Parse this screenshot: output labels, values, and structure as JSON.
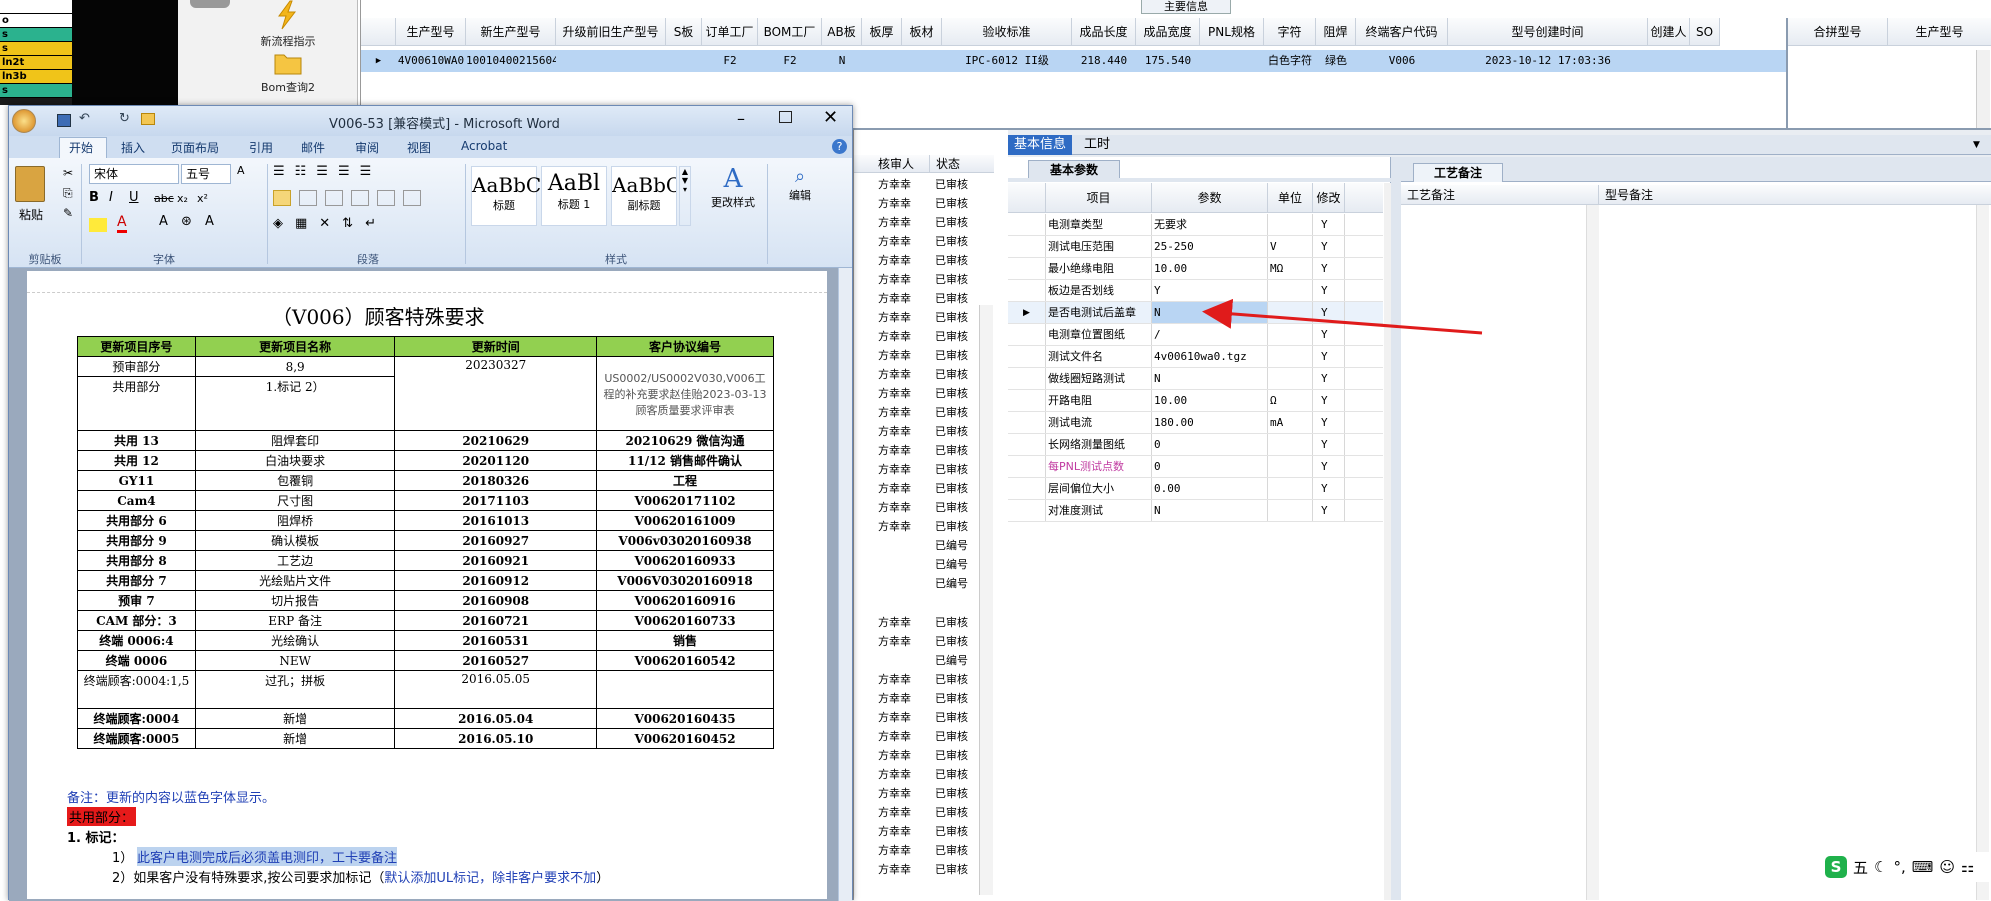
{
  "left_strip": {
    "items": [
      {
        "text": "",
        "bg": "#ffffff"
      },
      {
        "text": "o",
        "bg": "#ffffff"
      },
      {
        "text": "s",
        "bg": "#2bb28e"
      },
      {
        "text": "s",
        "bg": "#f0c419"
      },
      {
        "text": "ln2t",
        "bg": "#f0c419"
      },
      {
        "text": "ln3b",
        "bg": "#f0c419"
      },
      {
        "text": "s",
        "bg": "#2bb28e"
      }
    ]
  },
  "toolbar": {
    "new_flow_label": "新流程指示",
    "bom_label": "Bom查询2"
  },
  "top_grid": {
    "section_title": "主要信息",
    "headers": [
      "生产型号",
      "新生产型号",
      "升级前旧生产型号",
      "S板",
      "订单工厂",
      "BOM工厂",
      "AB板",
      "板厚",
      "板材",
      "验收标准",
      "成品长度",
      "成品宽度",
      "PNL规格",
      "字符",
      "阻焊",
      "终端客户代码",
      "型号创建时间",
      "创建人",
      "SO"
    ],
    "row": [
      "4V00610WA0",
      "10010400215604",
      "",
      "",
      "F2",
      "F2",
      "N",
      "",
      "",
      "IPC-6012 II级",
      "218.440",
      "175.540",
      "",
      "白色字符",
      "绿色",
      "V006",
      "2023-10-12 17:03:36",
      "",
      ""
    ],
    "right_headers": [
      "合拼型号",
      "生产型号"
    ]
  },
  "mid_col": {
    "headers": [
      "核审人",
      "状态"
    ],
    "rows": [
      [
        "方幸幸",
        "已审核"
      ],
      [
        "方幸幸",
        "已审核"
      ],
      [
        "方幸幸",
        "已审核"
      ],
      [
        "方幸幸",
        "已审核"
      ],
      [
        "方幸幸",
        "已审核"
      ],
      [
        "方幸幸",
        "已审核"
      ],
      [
        "方幸幸",
        "已审核"
      ],
      [
        "方幸幸",
        "已审核"
      ],
      [
        "方幸幸",
        "已审核"
      ],
      [
        "方幸幸",
        "已审核"
      ],
      [
        "方幸幸",
        "已审核"
      ],
      [
        "方幸幸",
        "已审核"
      ],
      [
        "方幸幸",
        "已审核"
      ],
      [
        "方幸幸",
        "已审核"
      ],
      [
        "方幸幸",
        "已审核"
      ],
      [
        "方幸幸",
        "已审核"
      ],
      [
        "方幸幸",
        "已审核"
      ],
      [
        "方幸幸",
        "已审核"
      ],
      [
        "方幸幸",
        "已审核"
      ],
      [
        "",
        "已编号"
      ],
      [
        "",
        "已编号"
      ],
      [
        "",
        "已编号"
      ],
      [
        "方幸幸",
        "已审核"
      ],
      [
        "方幸幸",
        "已审核"
      ],
      [
        "",
        "已编号"
      ],
      [
        "方幸幸",
        "已审核"
      ],
      [
        "方幸幸",
        "已审核"
      ],
      [
        "方幸幸",
        "已审核"
      ],
      [
        "方幸幸",
        "已审核"
      ],
      [
        "方幸幸",
        "已审核"
      ],
      [
        "方幸幸",
        "已审核"
      ],
      [
        "方幸幸",
        "已审核"
      ],
      [
        "方幸幸",
        "已审核"
      ],
      [
        "方幸幸",
        "已审核"
      ],
      [
        "方幸幸",
        "已审核"
      ],
      [
        "方幸幸",
        "已审核"
      ]
    ]
  },
  "right_panel": {
    "tabs": [
      "基本信息",
      "工时"
    ],
    "sub_tab": "基本参数",
    "craft_tab": "工艺备注",
    "param_headers": [
      "项目",
      "参数",
      "单位",
      "修改"
    ],
    "params": [
      [
        "电测章类型",
        "无要求",
        "",
        "Y"
      ],
      [
        "测试电压范围",
        "25-250",
        "V",
        "Y"
      ],
      [
        "最小绝缘电阻",
        "10.00",
        "MΩ",
        "Y"
      ],
      [
        "板边是否划线",
        "Y",
        "",
        "Y"
      ],
      [
        "是否电测试后盖章",
        "N",
        "",
        "Y"
      ],
      [
        "电测章位置图纸",
        "/",
        "",
        "Y"
      ],
      [
        "测试文件名",
        "4v00610wa0.tgz",
        "",
        "Y"
      ],
      [
        "做线圈短路测试",
        "N",
        "",
        "Y"
      ],
      [
        "开路电阻",
        "10.00",
        "Ω",
        "Y"
      ],
      [
        "测试电流",
        "180.00",
        "mA",
        "Y"
      ],
      [
        "长网络测量图纸",
        "0",
        "",
        "Y"
      ],
      [
        "每PNL测试点数",
        "0",
        "",
        "Y"
      ],
      [
        "层间偏位大小",
        "0.00",
        "",
        "Y"
      ],
      [
        "对准度测试",
        "N",
        "",
        "Y"
      ]
    ],
    "craft_headers": [
      "工艺备注",
      "型号备注"
    ]
  },
  "word": {
    "title": "V006-53 [兼容模式] - Microsoft Word",
    "tabs": [
      "开始",
      "插入",
      "页面布局",
      "引用",
      "邮件",
      "审阅",
      "视图",
      "Acrobat"
    ],
    "font_name": "宋体",
    "font_size": "五号",
    "groups": [
      "剪贴板",
      "字体",
      "段落",
      "样式"
    ],
    "paste_label": "粘贴",
    "styles": [
      {
        "sample": "AaBbC",
        "name": "标题"
      },
      {
        "sample": "AaBl",
        "name": "标题 1"
      },
      {
        "sample": "AaBbC",
        "name": "副标题"
      }
    ],
    "change_style": "更改样式",
    "edit": "编辑",
    "doc_title": "（V006）顾客特殊要求",
    "table_headers": [
      "更新项目序号",
      "更新项目名称",
      "更新时间",
      "客户协议编号"
    ],
    "table_rows": [
      [
        "预审部分",
        "8,9",
        "20230327",
        "US0002/US0002V030,V006工程的补充要求赵佳贻2023-03-13顾客质量要求评审表"
      ],
      [
        "共用部分",
        "1.标记 2）",
        "",
        ""
      ],
      [
        "共用 13",
        "阻焊套印",
        "20210629",
        "20210629 微信沟通"
      ],
      [
        "共用 12",
        "白油块要求",
        "20201120",
        "11/12 销售邮件确认"
      ],
      [
        "GY11",
        "包覆铜",
        "20180326",
        "工程"
      ],
      [
        "Cam4",
        "尺寸图",
        "20171103",
        "V00620171102"
      ],
      [
        "共用部分 6",
        "阻焊桥",
        "20161013",
        "V00620161009"
      ],
      [
        "共用部分 9",
        "确认模板",
        "20160927",
        "V006v03020160938"
      ],
      [
        "共用部分 8",
        "工艺边",
        "20160921",
        "V00620160933"
      ],
      [
        "共用部分 7",
        "光绘贴片文件",
        "20160912",
        "V006V03020160918"
      ],
      [
        "预审 7",
        "切片报告",
        "20160908",
        "V00620160916"
      ],
      [
        "CAM 部分：3",
        "ERP 备注",
        "20160721",
        "V00620160733"
      ],
      [
        "终端 0006:4",
        "光绘确认",
        "20160531",
        "销售"
      ],
      [
        "终端 0006",
        "NEW",
        "20160527",
        "V00620160542"
      ],
      [
        "终端顾客:0004:1,5",
        "过孔；拼板",
        "2016.05.05",
        ""
      ],
      [
        "终端顾客:0004",
        "新增",
        "2016.05.04",
        "V00620160435"
      ],
      [
        "终端顾客:0005",
        "新增",
        "2016.05.10",
        "V00620160452"
      ]
    ],
    "note": "备注：更新的内容以蓝色字体显示。",
    "shared_heading": "共用部分：",
    "item1": "1.   标记：",
    "item1_1_num": "1）",
    "item1_1": "此客户电测完成后必须盖电测印，工卡要备注",
    "item1_2_num": "2）",
    "item1_2_a": "如果客户没有特殊要求,按公司要求加标记（",
    "item1_2_b": "默认添加UL标记，除非客户要求不加",
    "item1_2_c": "）"
  },
  "ime": {
    "label": "五"
  },
  "colors": {
    "accent": "#2e6bc4",
    "arrow": "#e01b1b",
    "selected_row": "#b9d5f3"
  }
}
